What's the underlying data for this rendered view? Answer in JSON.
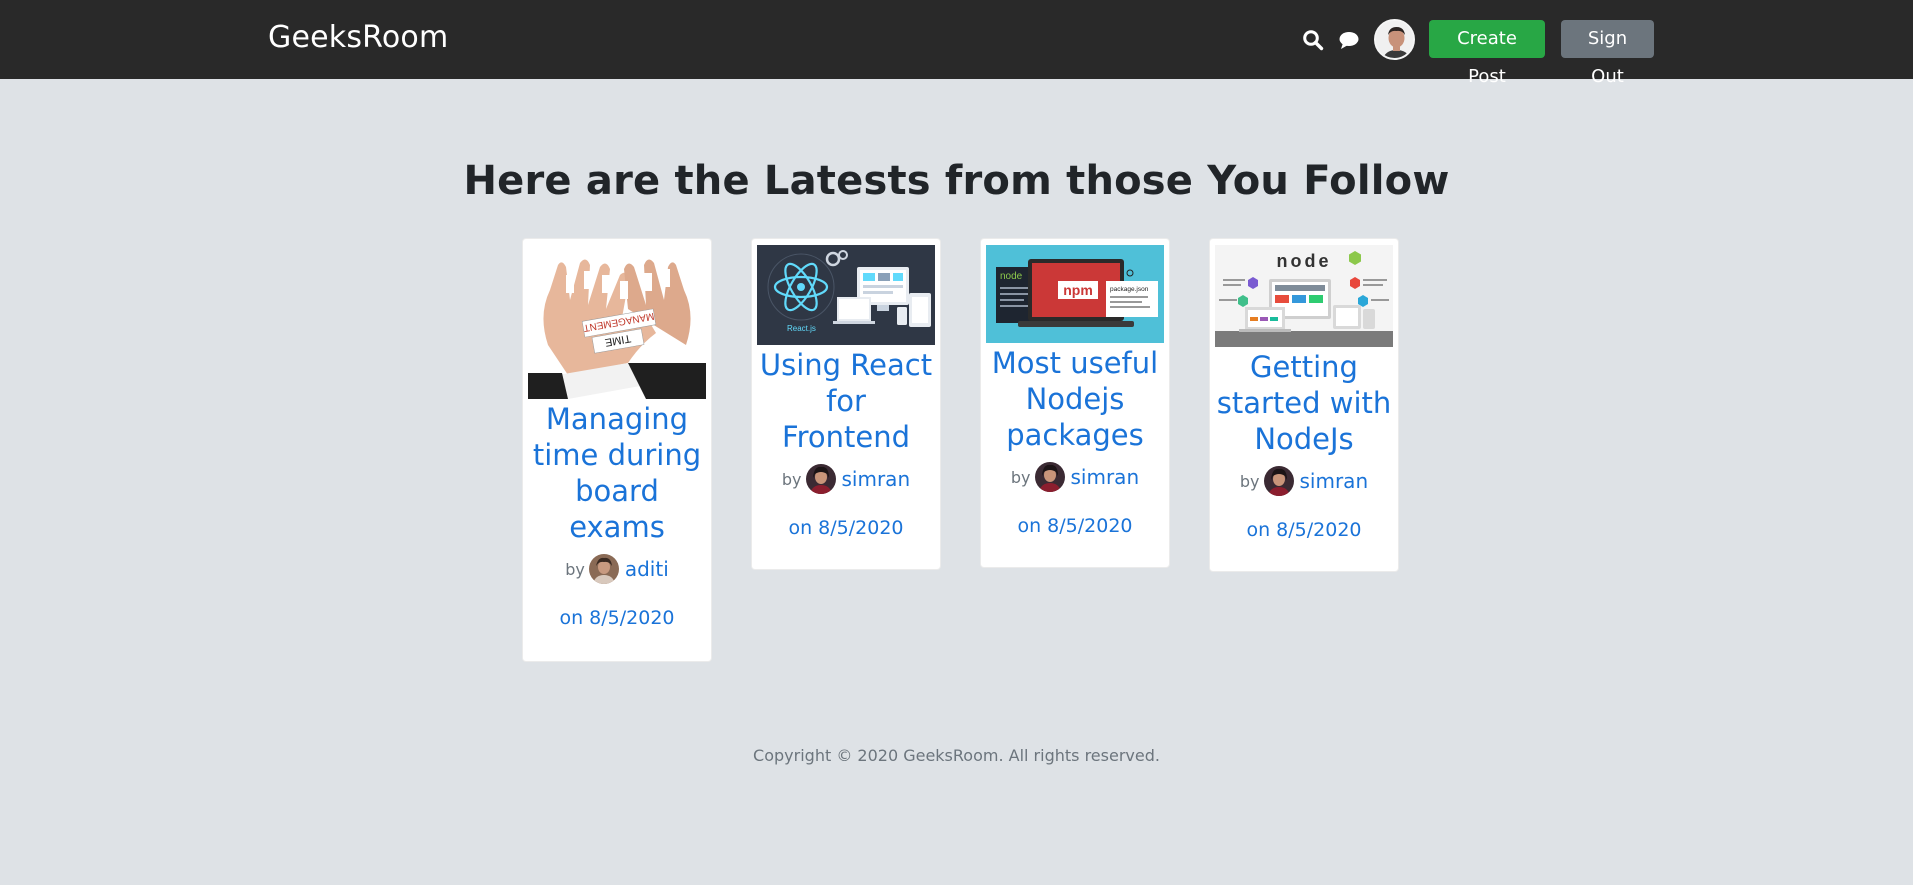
{
  "nav": {
    "brand": "GeeksRoom",
    "search_icon": "search-icon",
    "messages_icon": "chat-bubble-icon",
    "create_post_label": "Create Post",
    "sign_out_label": "Sign Out"
  },
  "main": {
    "heading": "Here are the Latests from those You Follow"
  },
  "posts": [
    {
      "title": "Managing time during board exams",
      "by": "by",
      "author": "aditi",
      "date": "on 8/5/2020",
      "image": "time-management-hands-image"
    },
    {
      "title": "Using React for Frontend",
      "by": "by",
      "author": "simran",
      "date": "on 8/5/2020",
      "image": "reactjs-devices-image"
    },
    {
      "title": "Most useful Nodejs packages",
      "by": "by",
      "author": "simran",
      "date": "on 8/5/2020",
      "image": "node-npm-laptop-image"
    },
    {
      "title": "Getting started with NodeJs",
      "by": "by",
      "author": "simran",
      "date": "on 8/5/2020",
      "image": "nodejs-devices-image"
    }
  ],
  "footer": {
    "copyright": "Copyright © 2020 GeeksRoom. All rights reserved."
  },
  "colors": {
    "navbar": "#292929",
    "background": "#dee2e6",
    "link": "#1a73d8",
    "create_button": "#28a745",
    "sign_out_button": "#6c757d"
  }
}
